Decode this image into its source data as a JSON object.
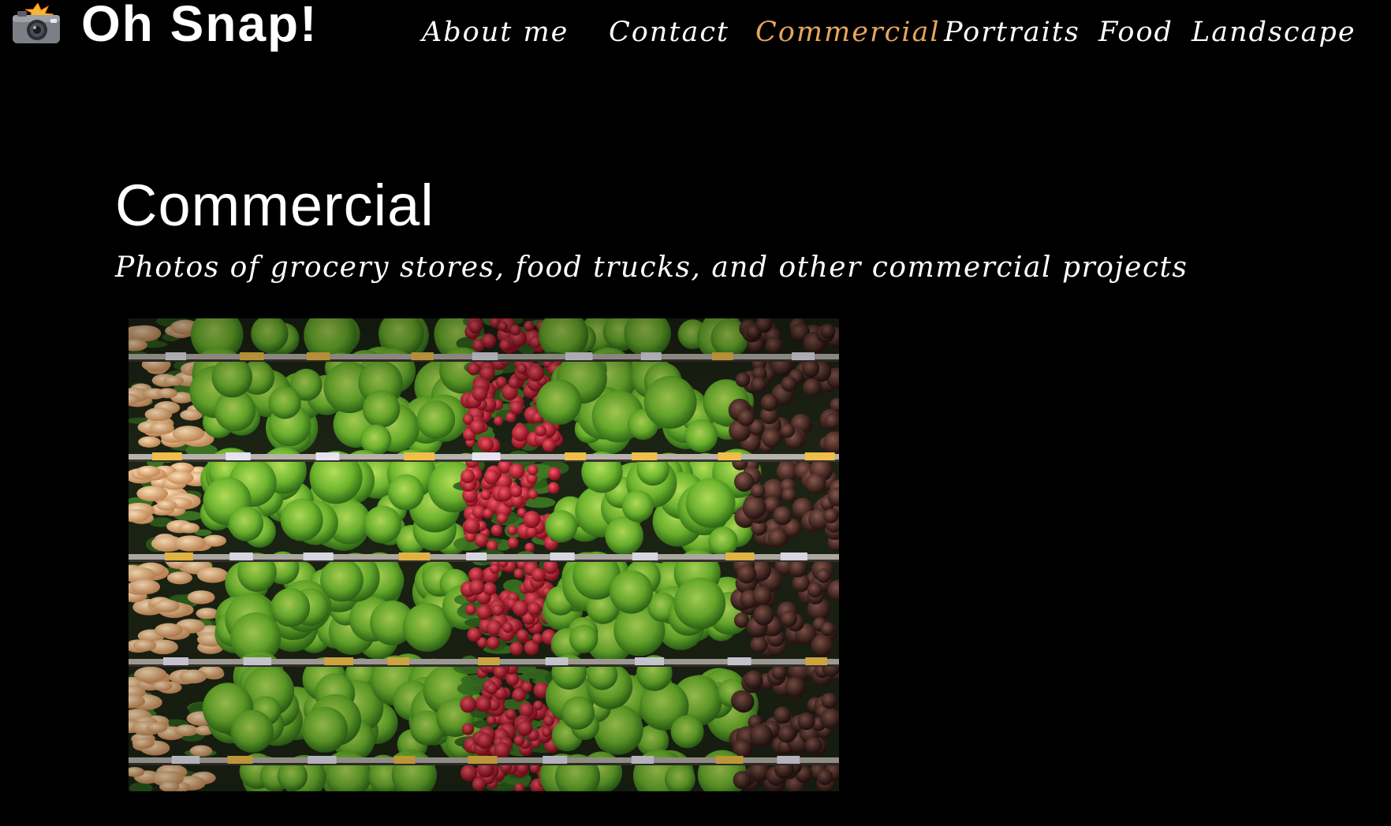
{
  "header": {
    "logo_icon": "camera-flash-icon",
    "brand": "Oh Snap!"
  },
  "nav": {
    "items": [
      {
        "label": "About me"
      },
      {
        "label": "Contact"
      },
      {
        "label": "Commercial",
        "active": true
      },
      {
        "label": "Portraits"
      },
      {
        "label": "Food"
      },
      {
        "label": "Landscape"
      }
    ],
    "active_color": "#e7a55a"
  },
  "main": {
    "title": "Commercial",
    "subtitle": "Photos of grocery stores, food trucks, and other commercial projects",
    "photo": {
      "subject": "grocery-produce-shelves-photo"
    }
  },
  "colors": {
    "background": "#000000",
    "text": "#ffffff",
    "accent": "#e7a55a"
  }
}
